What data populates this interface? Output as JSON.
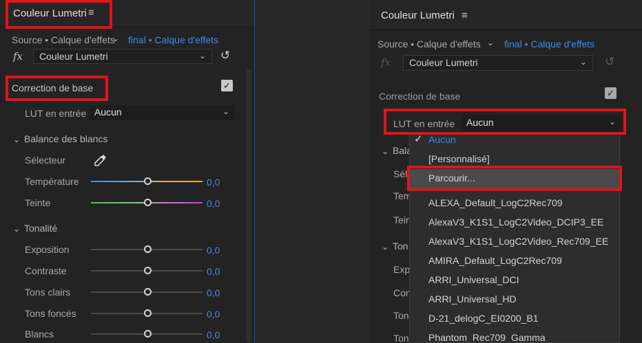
{
  "left": {
    "tab_title": "Couleur Lumetri",
    "menu_icon": "hamburger-icon",
    "source_label": "Source • Calque d'effets",
    "source_active": "final • Calque d'effets",
    "fx_label": "fx",
    "effect_name": "Couleur Lumetri",
    "section_title": "Correction de base",
    "lut_label": "LUT en entrée",
    "lut_value": "Aucun",
    "white_balance_title": "Balance des blancs",
    "selector_label": "Sélecteur",
    "temperature_label": "Température",
    "temperature_value": "0,0",
    "tint_label": "Teinte",
    "tint_value": "0,0",
    "tonality_title": "Tonalité",
    "exposure_label": "Exposition",
    "exposure_value": "0,0",
    "contrast_label": "Contraste",
    "contrast_value": "0,0",
    "highlights_label": "Tons clairs",
    "highlights_value": "0,0",
    "shadows_label": "Tons foncés",
    "shadows_value": "0,0",
    "whites_label": "Blancs",
    "whites_value": "0,0"
  },
  "right": {
    "tab_title": "Couleur Lumetri",
    "source_label": "Source • Calque d'effets",
    "source_active": "final • Calque d'effets",
    "fx_label": "fx",
    "effect_name": "Couleur Lumetri",
    "section_title": "Correction de base",
    "lut_label": "LUT en entrée",
    "lut_value": "Aucun",
    "bg_labels": [
      "Bala",
      "Séle",
      "Tem",
      "Tein",
      "Ton",
      "Exp",
      "Con",
      "Ton",
      "Ton"
    ],
    "dropdown": {
      "items": [
        {
          "label": "Aucun",
          "selected": true
        },
        {
          "label": "[Personnalisé]"
        },
        {
          "label": "Parcourir...",
          "highlighted": true
        },
        {
          "label": "ALEXA_Default_LogC2Rec709"
        },
        {
          "label": "AlexaV3_K1S1_LogC2Video_DCIP3_EE"
        },
        {
          "label": "AlexaV3_K1S1_LogC2Video_Rec709_EE"
        },
        {
          "label": "AMIRA_Default_LogC2Rec709"
        },
        {
          "label": "ARRI_Universal_DCI"
        },
        {
          "label": "ARRI_Universal_HD"
        },
        {
          "label": "D-21_delogC_EI0200_B1"
        },
        {
          "label": "Phantom_Rec709_Gamma"
        }
      ]
    }
  },
  "colors": {
    "accent_blue": "#3d8ce8",
    "highlight_red": "#e0141b",
    "temperature_gradient": [
      "#3f8fe0",
      "#e5a63a"
    ],
    "tint_gradient": [
      "#3dd23d",
      "#d23dd2"
    ]
  }
}
